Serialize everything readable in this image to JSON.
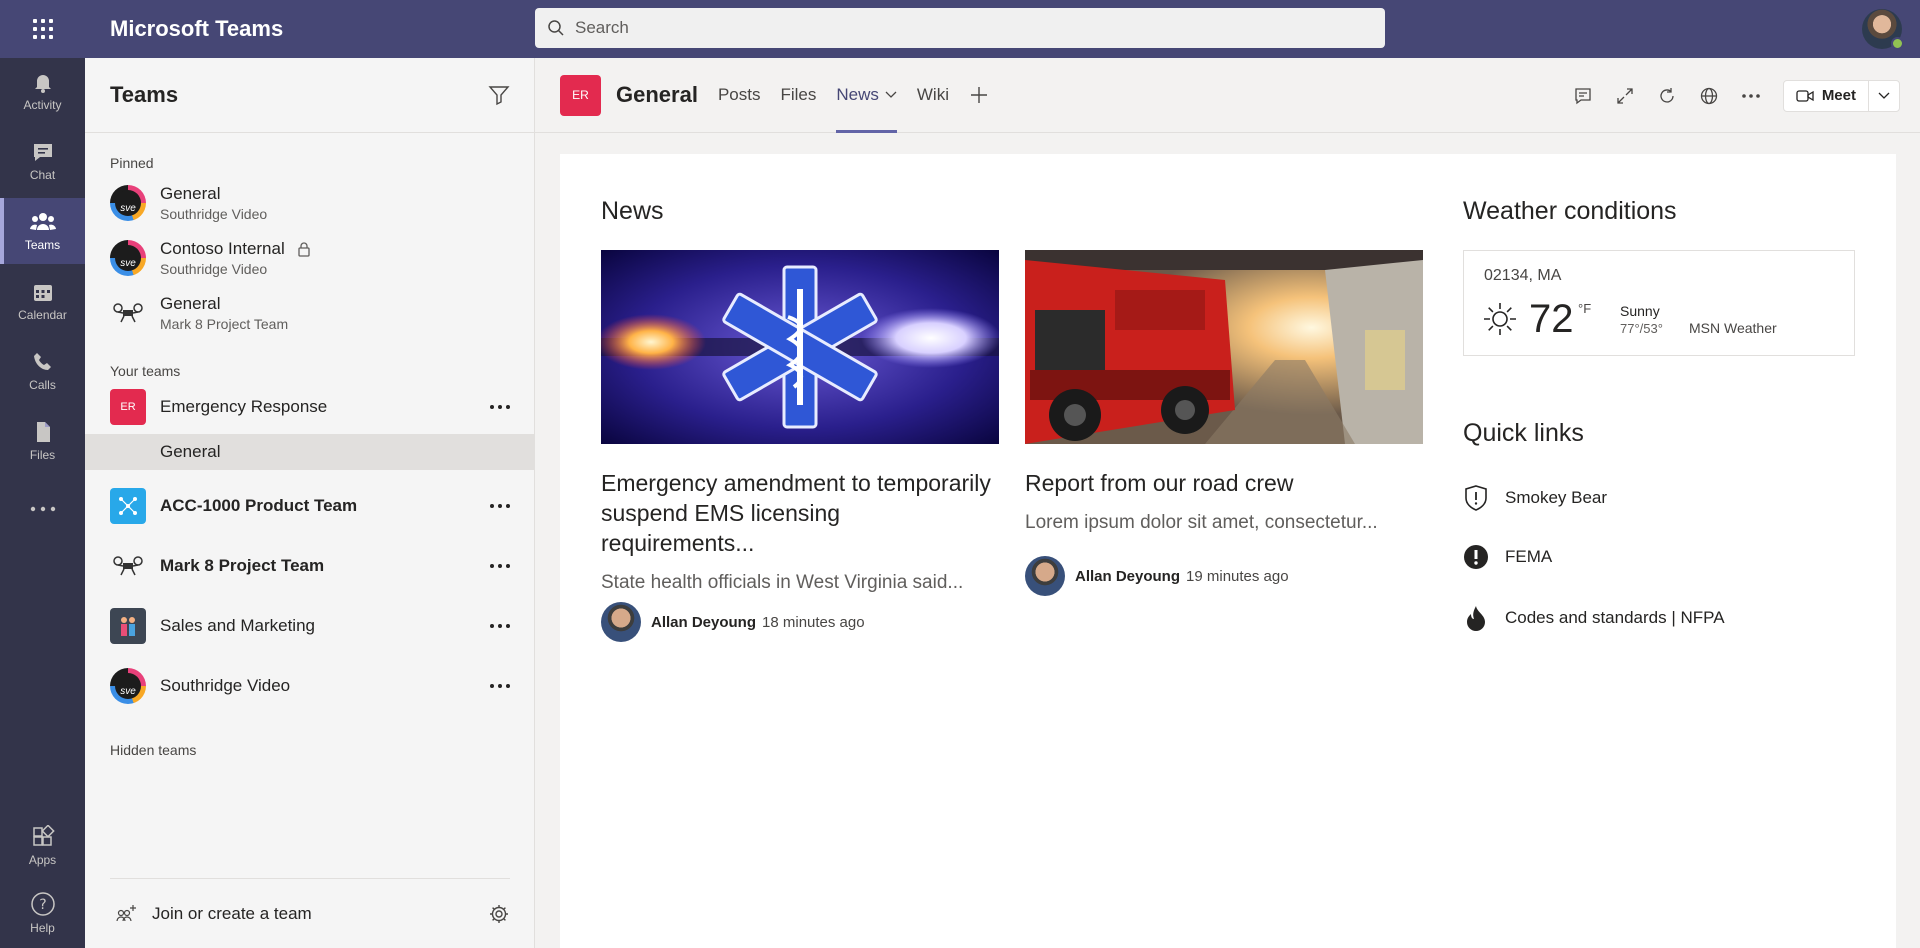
{
  "app": {
    "title": "Microsoft Teams"
  },
  "search": {
    "placeholder": "Search"
  },
  "rail": {
    "items": [
      {
        "label": "Activity",
        "icon": "bell-icon"
      },
      {
        "label": "Chat",
        "icon": "chat-icon"
      },
      {
        "label": "Teams",
        "icon": "teams-icon",
        "active": true
      },
      {
        "label": "Calendar",
        "icon": "calendar-icon"
      },
      {
        "label": "Calls",
        "icon": "phone-icon"
      },
      {
        "label": "Files",
        "icon": "file-icon"
      }
    ],
    "bottom": [
      {
        "label": "Apps",
        "icon": "apps-icon"
      },
      {
        "label": "Help",
        "icon": "help-icon"
      }
    ]
  },
  "teams_pane": {
    "title": "Teams",
    "pinned_label": "Pinned",
    "pinned": [
      {
        "name": "General",
        "team": "Southridge Video"
      },
      {
        "name": "Contoso Internal",
        "team": "Southridge Video"
      },
      {
        "name": "General",
        "team": "Mark 8 Project Team"
      }
    ],
    "your_teams_label": "Your teams",
    "teams": [
      {
        "name": "Emergency Response",
        "initials": "ER",
        "channel": "General"
      },
      {
        "name": "ACC-1000 Product Team"
      },
      {
        "name": "Mark 8 Project Team"
      },
      {
        "name": "Sales and Marketing"
      },
      {
        "name": "Southridge Video"
      }
    ],
    "hidden_label": "Hidden teams",
    "join_label": "Join or create a team"
  },
  "channel": {
    "initials": "ER",
    "name": "General",
    "tabs": [
      "Posts",
      "Files",
      "News",
      "Wiki"
    ],
    "active_tab": "News",
    "meet_label": "Meet"
  },
  "news": {
    "title": "News",
    "articles": [
      {
        "title": "Emergency amendment to temporarily suspend EMS licensing requirements...",
        "snippet": "State health officials in West Virginia said...",
        "author": "Allan Deyoung",
        "time": "18 minutes ago"
      },
      {
        "title": "Report from our road crew",
        "snippet": "Lorem ipsum dolor sit amet, consectetur...",
        "author": "Allan Deyoung",
        "time": "19 minutes ago"
      }
    ]
  },
  "weather": {
    "title": "Weather conditions",
    "location": "02134, MA",
    "temp": "72",
    "unit": "°F",
    "condition": "Sunny",
    "range": "77°/53°",
    "source": "MSN Weather"
  },
  "quick_links": {
    "title": "Quick links",
    "items": [
      {
        "label": "Smokey Bear",
        "icon": "shield-icon"
      },
      {
        "label": "FEMA",
        "icon": "alert-icon"
      },
      {
        "label": "Codes and standards | NFPA",
        "icon": "flame-icon"
      }
    ]
  },
  "colors": {
    "brand": "#464775",
    "rail": "#33344a",
    "accent": "#6264a7",
    "er": "#e32a4f"
  }
}
